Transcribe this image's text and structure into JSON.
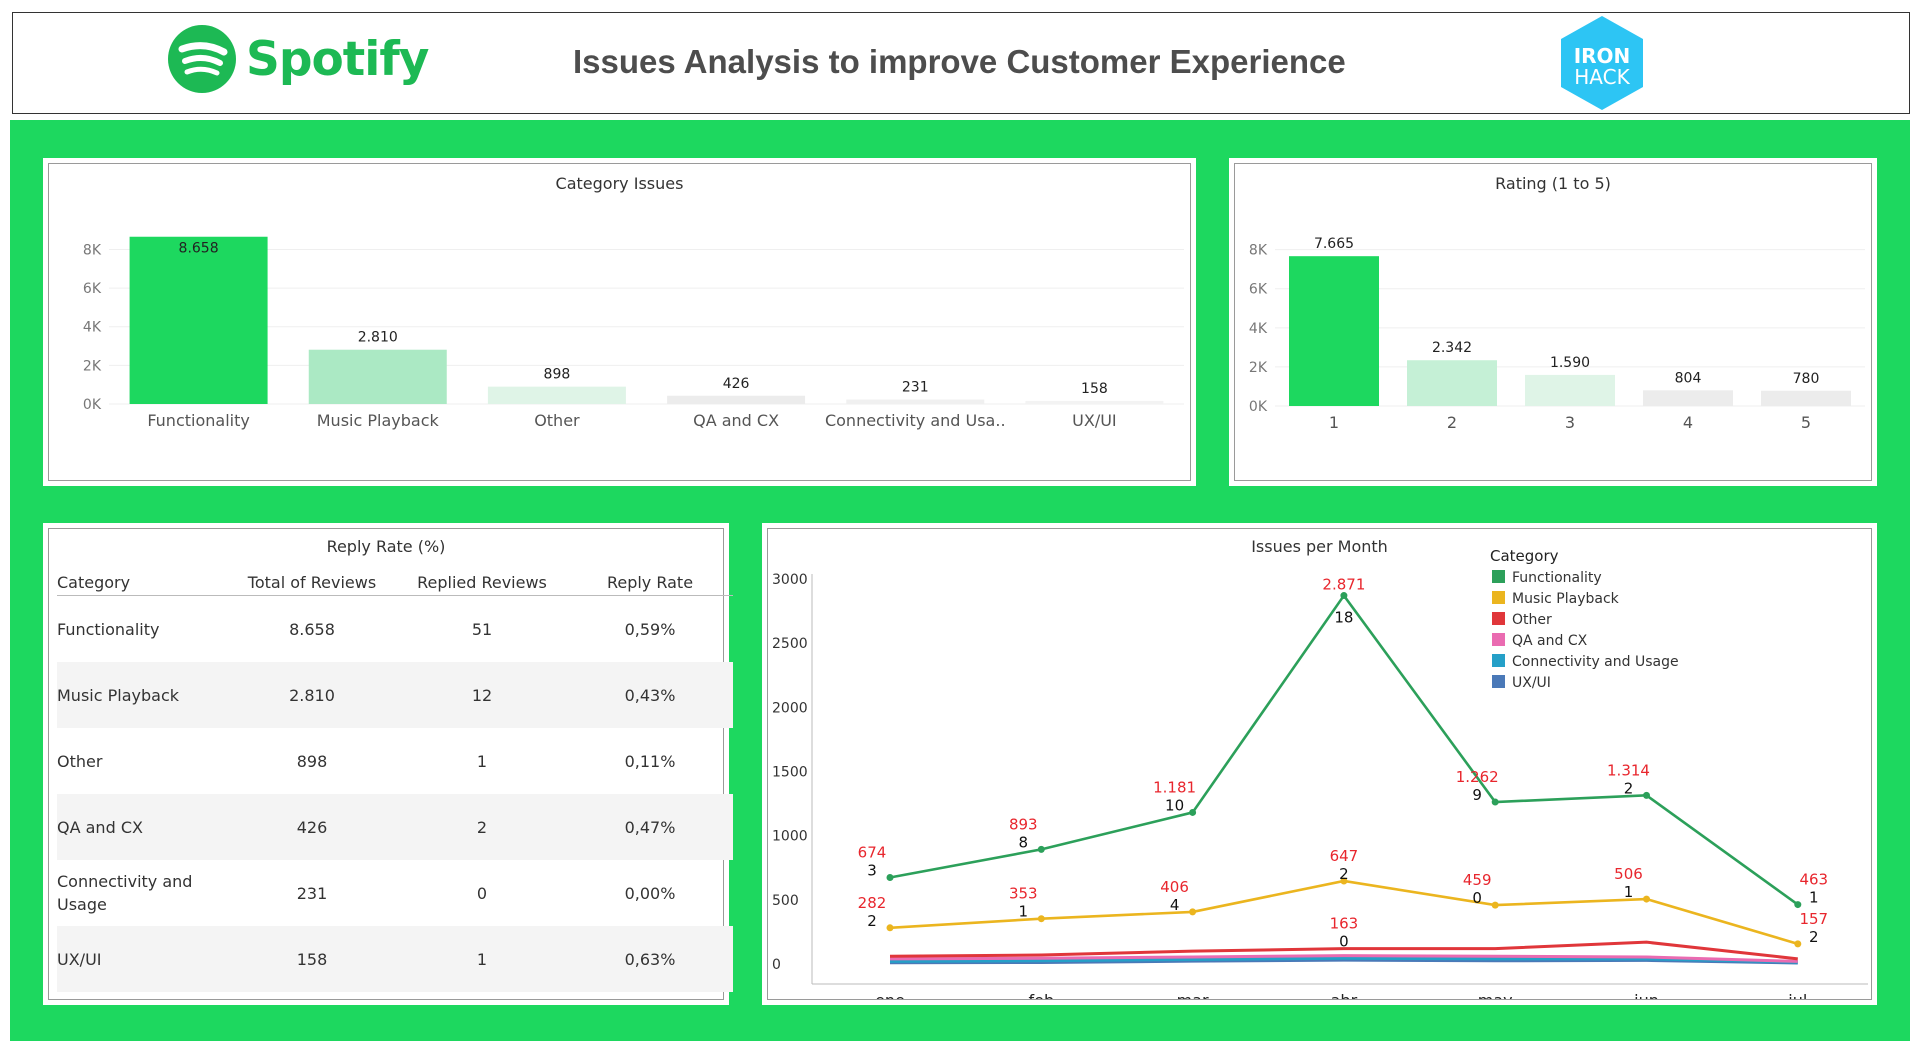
{
  "header": {
    "brand": "Spotify",
    "title": "Issues Analysis to improve Customer Experience",
    "partner_line1": "IRON",
    "partner_line2": "HACK"
  },
  "colors": {
    "spotify_green": "#1DB954",
    "dashboard_bg": "#1DD85F",
    "ironhack_blue": "#2DC5F4",
    "label_red": "#e8262d"
  },
  "chart_data": [
    {
      "type": "bar",
      "title": "Category Issues",
      "categories": [
        "Functionality",
        "Music Playback",
        "Other",
        "QA and CX",
        "Connectivity and Usa..",
        "UX/UI"
      ],
      "values": [
        8658,
        2810,
        898,
        426,
        231,
        158
      ],
      "value_labels": [
        "8.658",
        "2.810",
        "898",
        "426",
        "231",
        "158"
      ],
      "ylim": [
        0,
        8800
      ],
      "yticks": [
        "0K",
        "2K",
        "4K",
        "6K",
        "8K"
      ],
      "colors": [
        "#1DD85F",
        "#abe9c4",
        "#dff4e7",
        "#ececec",
        "#f0f0f0",
        "#f3f3f3"
      ],
      "grid": true
    },
    {
      "type": "bar",
      "title": "Rating (1 to 5)",
      "categories": [
        "1",
        "2",
        "3",
        "4",
        "5"
      ],
      "values": [
        7665,
        2342,
        1590,
        804,
        780
      ],
      "value_labels": [
        "7.665",
        "2.342",
        "1.590",
        "804",
        "780"
      ],
      "ylim": [
        0,
        8800
      ],
      "yticks": [
        "0K",
        "2K",
        "4K",
        "6K",
        "8K"
      ],
      "colors": [
        "#1DD85F",
        "#c5f0d6",
        "#dff4e7",
        "#ececec",
        "#ececec"
      ],
      "grid": true
    },
    {
      "type": "table",
      "title": "Reply Rate (%)",
      "columns": [
        "Category",
        "Total of Reviews",
        "Replied Reviews",
        "Reply Rate"
      ],
      "rows": [
        [
          "Functionality",
          "8.658",
          "51",
          "0,59%"
        ],
        [
          "Music Playback",
          "2.810",
          "12",
          "0,43%"
        ],
        [
          "Other",
          "898",
          "1",
          "0,11%"
        ],
        [
          "QA and CX",
          "426",
          "2",
          "0,47%"
        ],
        [
          "Connectivity and Usage",
          "231",
          "0",
          "0,00%"
        ],
        [
          "UX/UI",
          "158",
          "1",
          "0,63%"
        ]
      ]
    },
    {
      "type": "line",
      "title": "Issues per Month",
      "x": [
        "ene",
        "feb",
        "mar",
        "abr",
        "may",
        "jun",
        "jul"
      ],
      "ylim": [
        0,
        3000
      ],
      "yticks": [
        0,
        500,
        1000,
        1500,
        2000,
        2500,
        3000
      ],
      "legend_title": "Category",
      "legend_position": "top-right",
      "series": [
        {
          "name": "Functionality",
          "color": "#2ca05a",
          "values": [
            674,
            893,
            1181,
            2871,
            1262,
            1314,
            463
          ],
          "show_markers": true
        },
        {
          "name": "Music Playback",
          "color": "#ebb51f",
          "values": [
            282,
            353,
            406,
            647,
            459,
            506,
            157
          ],
          "show_markers": true
        },
        {
          "name": "Other",
          "color": "#e0363a",
          "values": [
            60,
            70,
            100,
            120,
            120,
            170,
            40
          ],
          "show_markers": false
        },
        {
          "name": "QA and CX",
          "color": "#ea6bb1",
          "values": [
            40,
            45,
            55,
            65,
            60,
            55,
            20
          ],
          "show_markers": false
        },
        {
          "name": "Connectivity and Usage",
          "color": "#25a0c8",
          "values": [
            20,
            25,
            35,
            45,
            40,
            40,
            15
          ],
          "show_markers": false
        },
        {
          "name": "UX/UI",
          "color": "#4a79b8",
          "values": [
            10,
            12,
            22,
            30,
            25,
            28,
            8
          ],
          "show_markers": false
        }
      ],
      "annotations": [
        {
          "x": "ene",
          "y": 674,
          "text": "674",
          "color": "red"
        },
        {
          "x": "ene",
          "y": 674,
          "text": "3",
          "color": "black"
        },
        {
          "x": "feb",
          "y": 893,
          "text": "893",
          "color": "red"
        },
        {
          "x": "feb",
          "y": 893,
          "text": "8",
          "color": "black"
        },
        {
          "x": "mar",
          "y": 1181,
          "text": "1.181",
          "color": "red"
        },
        {
          "x": "mar",
          "y": 1181,
          "text": "10",
          "color": "black"
        },
        {
          "x": "abr",
          "y": 2871,
          "text": "2.871",
          "color": "red"
        },
        {
          "x": "abr",
          "y": 2871,
          "text": "18",
          "color": "black"
        },
        {
          "x": "may",
          "y": 1262,
          "text": "1.262",
          "color": "red"
        },
        {
          "x": "may",
          "y": 1262,
          "text": "9",
          "color": "black"
        },
        {
          "x": "jun",
          "y": 1314,
          "text": "1.314",
          "color": "red"
        },
        {
          "x": "jun",
          "y": 1314,
          "text": "2",
          "color": "black"
        },
        {
          "x": "jul",
          "y": 463,
          "text": "463",
          "color": "red"
        },
        {
          "x": "jul",
          "y": 463,
          "text": "1",
          "color": "black"
        },
        {
          "x": "ene",
          "y": 282,
          "text": "282",
          "color": "red"
        },
        {
          "x": "ene",
          "y": 282,
          "text": "2",
          "color": "black"
        },
        {
          "x": "feb",
          "y": 353,
          "text": "353",
          "color": "red"
        },
        {
          "x": "feb",
          "y": 353,
          "text": "1",
          "color": "black"
        },
        {
          "x": "mar",
          "y": 406,
          "text": "406",
          "color": "red"
        },
        {
          "x": "mar",
          "y": 406,
          "text": "4",
          "color": "black"
        },
        {
          "x": "abr",
          "y": 647,
          "text": "647",
          "color": "red"
        },
        {
          "x": "abr",
          "y": 647,
          "text": "2",
          "color": "black"
        },
        {
          "x": "may",
          "y": 459,
          "text": "459",
          "color": "red"
        },
        {
          "x": "may",
          "y": 459,
          "text": "0",
          "color": "black"
        },
        {
          "x": "jun",
          "y": 506,
          "text": "506",
          "color": "red"
        },
        {
          "x": "jun",
          "y": 506,
          "text": "1",
          "color": "black"
        },
        {
          "x": "jul",
          "y": 157,
          "text": "157",
          "color": "red"
        },
        {
          "x": "jul",
          "y": 157,
          "text": "2",
          "color": "black"
        },
        {
          "x": "abr",
          "y": 120,
          "text": "163",
          "color": "red"
        },
        {
          "x": "abr",
          "y": 120,
          "text": "0",
          "color": "black"
        }
      ]
    }
  ]
}
